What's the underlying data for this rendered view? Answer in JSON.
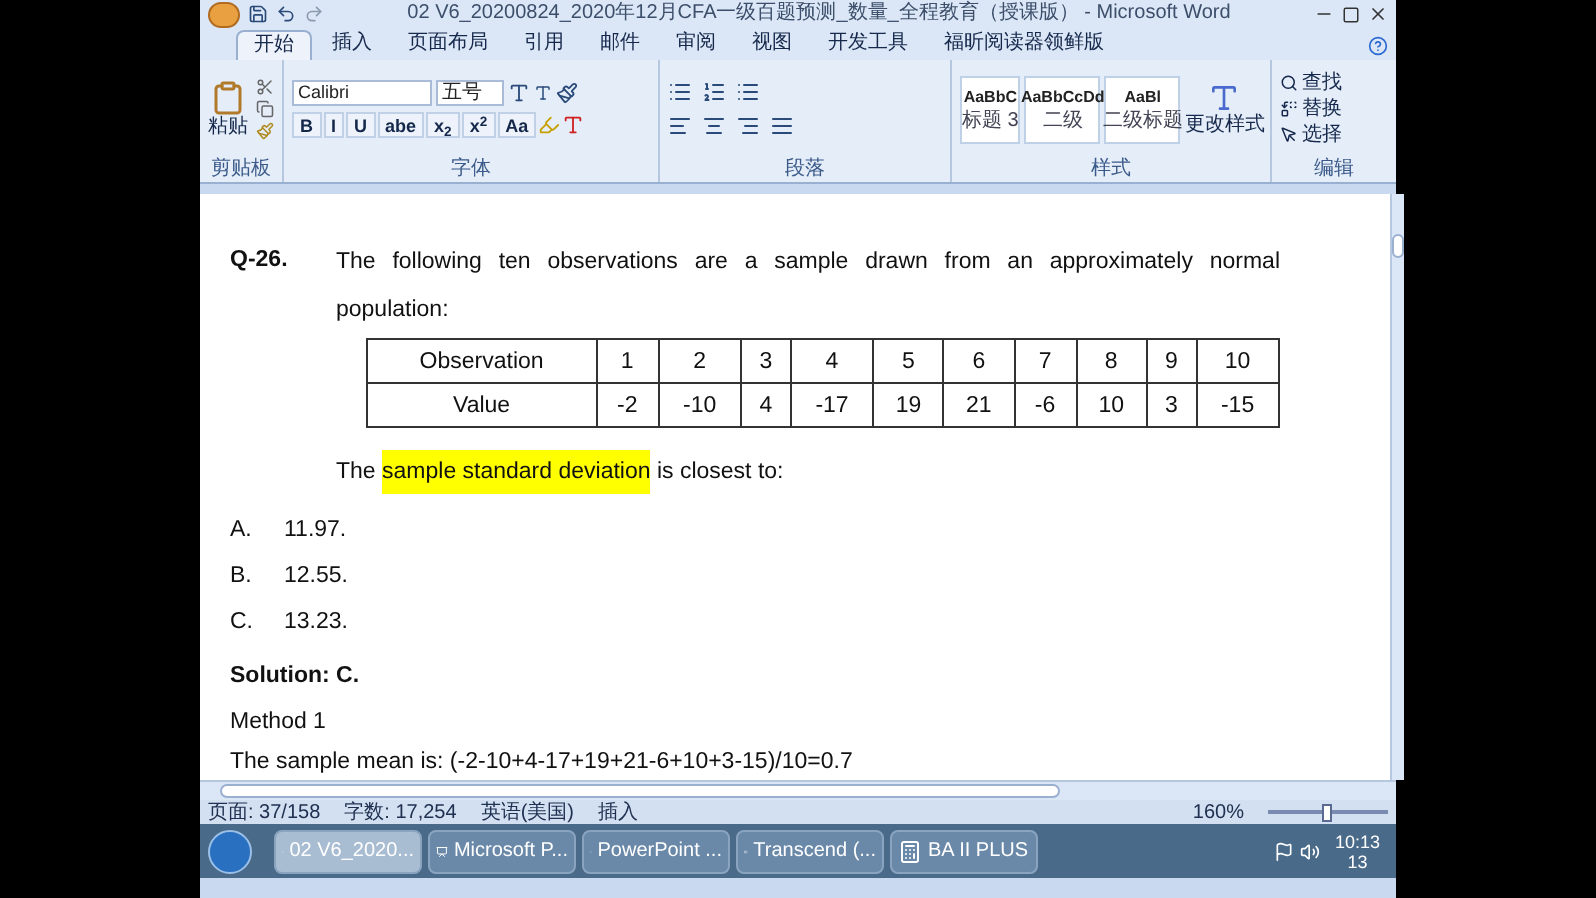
{
  "window": {
    "title": "02 V6_20200824_2020年12月CFA一级百题预测_数量_全程教育（授课版） - Microsoft Word"
  },
  "tabs": [
    {
      "label": "开始",
      "selected": true
    },
    {
      "label": "插入",
      "selected": false
    },
    {
      "label": "页面布局",
      "selected": false
    },
    {
      "label": "引用",
      "selected": false
    },
    {
      "label": "邮件",
      "selected": false
    },
    {
      "label": "审阅",
      "selected": false
    },
    {
      "label": "视图",
      "selected": false
    },
    {
      "label": "开发工具",
      "selected": false
    },
    {
      "label": "福昕阅读器领鲜版",
      "selected": false
    }
  ],
  "ribbon": {
    "clipboard": {
      "paste": "粘贴",
      "label": "剪贴板"
    },
    "font": {
      "name": "Calibri",
      "size": "五号",
      "format_buttons": [
        "B",
        "I",
        "U",
        "abe",
        "x$_{2}$",
        "x$^{2}$",
        "Aa"
      ],
      "label": "字体"
    },
    "paragraph": {
      "label": "段落"
    },
    "styles": {
      "items": [
        {
          "sample": "AaBbC",
          "name": "标题 3"
        },
        {
          "sample": "AaBbCcDd",
          "name": "二级"
        },
        {
          "sample": "AaBl",
          "name": "二级标题"
        }
      ],
      "change": "更改样式",
      "label": "样式"
    },
    "editing": {
      "items": [
        "查找",
        "替换",
        "选择"
      ],
      "label": "编辑"
    }
  },
  "document": {
    "question": {
      "number": "Q-26.",
      "text": "The following ten observations are a sample drawn from an approximately normal population:"
    },
    "table": {
      "rows": [
        [
          "Observation",
          "1",
          "2",
          "3",
          "4",
          "5",
          "6",
          "7",
          "8",
          "9",
          "10"
        ],
        [
          "Value",
          "-2",
          "-10",
          "4",
          "-17",
          "19",
          "21",
          "-6",
          "10",
          "3",
          "-15"
        ]
      ]
    },
    "prompt": [
      {
        "text": "The ",
        "highlighted": false
      },
      {
        "text": "sample standard deviation",
        "highlighted": true
      },
      {
        "text": " is closest to:",
        "highlighted": false
      }
    ],
    "options": [
      {
        "letter": "A.",
        "text": "11.97."
      },
      {
        "letter": "B.",
        "text": "12.55."
      },
      {
        "letter": "C.",
        "text": "13.23."
      }
    ],
    "solution": "Solution: C.",
    "method": "Method 1",
    "last_line": "The sample mean is: (-2-10+4-17+19+21-6+10+3-15)/10=0.7"
  },
  "status_bar": {
    "page": "页面: 37/158",
    "words": "字数: 17,254",
    "language": "英语(美国)",
    "mode": "插入",
    "zoom": "160%",
    "zoom_slider": {
      "level": 0.5
    }
  },
  "taskbar": {
    "items": [
      {
        "label": "02 V6_2020...",
        "selected": true
      },
      {
        "label": "Microsoft P...",
        "selected": false
      },
      {
        "label": "PowerPoint ...",
        "selected": false
      },
      {
        "label": "Transcend (...",
        "selected": false
      },
      {
        "label": "BA II PLUS",
        "selected": false
      }
    ],
    "time": "10:13",
    "date": "13"
  }
}
